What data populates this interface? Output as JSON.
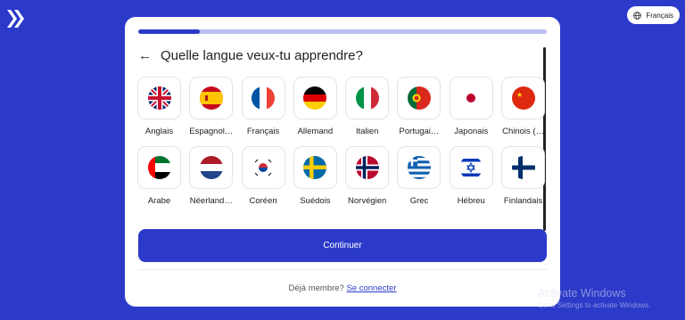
{
  "header": {
    "language_button": "Français",
    "language_icon": "globe-icon",
    "logo_icon": "arrow-logo-icon"
  },
  "card": {
    "progress_percent": 15,
    "back_icon": "arrow-left-icon",
    "title": "Quelle langue veux-tu apprendre?",
    "languages": [
      {
        "label": "Anglais",
        "flag": "uk-flag-icon"
      },
      {
        "label": "Espagnol…",
        "flag": "spain-flag-icon"
      },
      {
        "label": "Français",
        "flag": "france-flag-icon"
      },
      {
        "label": "Allemand",
        "flag": "germany-flag-icon"
      },
      {
        "label": "Italien",
        "flag": "italy-flag-icon"
      },
      {
        "label": "Portugai…",
        "flag": "portugal-flag-icon"
      },
      {
        "label": "Japonais",
        "flag": "japan-flag-icon"
      },
      {
        "label": "Chinois (…",
        "flag": "china-flag-icon"
      },
      {
        "label": "Arabe",
        "flag": "uae-flag-icon"
      },
      {
        "label": "Néerland…",
        "flag": "netherlands-flag-icon"
      },
      {
        "label": "Coréen",
        "flag": "korea-flag-icon"
      },
      {
        "label": "Suédois",
        "flag": "sweden-flag-icon"
      },
      {
        "label": "Norvégien",
        "flag": "norway-flag-icon"
      },
      {
        "label": "Grec",
        "flag": "greece-flag-icon"
      },
      {
        "label": "Hébreu",
        "flag": "israel-flag-icon"
      },
      {
        "label": "Finlandais",
        "flag": "finland-flag-icon"
      }
    ],
    "continue_label": "Continuer",
    "footer_text": "Déjà membre?",
    "login_link": "Se connecter"
  },
  "watermark": {
    "title": "Activate Windows",
    "subtitle": "Go to Settings to activate Windows."
  },
  "colors": {
    "background": "#2b3ac9",
    "accent": "#2b3ac9",
    "progress_track": "#b9bff0"
  }
}
